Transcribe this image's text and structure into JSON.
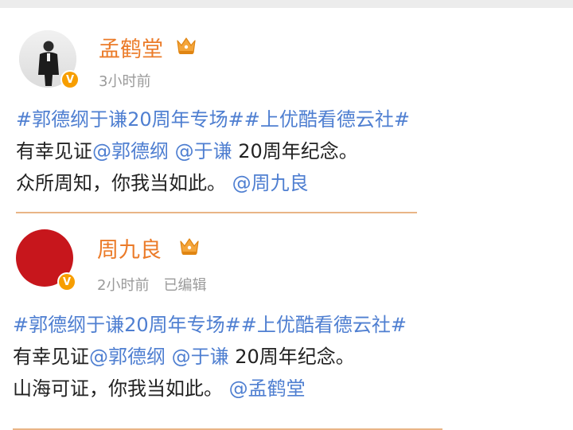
{
  "posts": [
    {
      "username": "孟鹤堂",
      "time": "3小时前",
      "edited": "",
      "verified_mark": "V",
      "lines": {
        "hashtags": "#郭德纲于谦20周年专场##上优酷看德云社#",
        "line2_prefix": "有幸见证",
        "mention_a": "@郭德纲",
        "mention_b": "@于谦",
        "line2_suffix": " 20周年纪念。",
        "line3_text": "众所周知，你我当如此。",
        "line3_mention": "@周九良"
      }
    },
    {
      "username": "周九良",
      "time": "2小时前",
      "edited": "已编辑",
      "verified_mark": "V",
      "lines": {
        "hashtags": "#郭德纲于谦20周年专场##上优酷看德云社#",
        "line2_prefix": "有幸见证",
        "mention_a": "@郭德纲",
        "mention_b": "@于谦",
        "line2_suffix": " 20周年纪念。",
        "line3_text": "山海可证，你我当如此。",
        "line3_mention": "@孟鹤堂"
      }
    }
  ],
  "colors": {
    "username": "#eb7b29",
    "link": "#4f7fd1",
    "meta": "#9a9a9a",
    "verified": "#f79e00",
    "divider": "#e9b586",
    "avatar2": "#c7161c"
  },
  "icons": {
    "verified": "verified-badge-icon",
    "vip": "vip-crown-icon"
  }
}
